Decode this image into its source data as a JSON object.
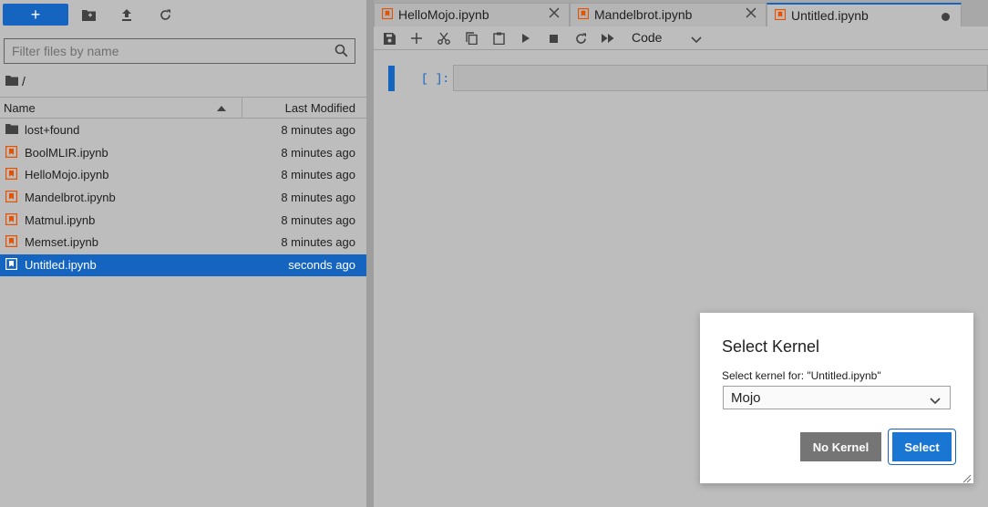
{
  "toolbar": {
    "new_label": "+"
  },
  "filter": {
    "placeholder": "Filter files by name"
  },
  "breadcrumb": {
    "root": "/"
  },
  "listing": {
    "name_header": "Name",
    "modified_header": "Last Modified",
    "items": [
      {
        "name": "lost+found",
        "modified": "8 minutes ago",
        "type": "folder"
      },
      {
        "name": "BoolMLIR.ipynb",
        "modified": "8 minutes ago",
        "type": "notebook"
      },
      {
        "name": "HelloMojo.ipynb",
        "modified": "8 minutes ago",
        "type": "notebook"
      },
      {
        "name": "Mandelbrot.ipynb",
        "modified": "8 minutes ago",
        "type": "notebook"
      },
      {
        "name": "Matmul.ipynb",
        "modified": "8 minutes ago",
        "type": "notebook"
      },
      {
        "name": "Memset.ipynb",
        "modified": "8 minutes ago",
        "type": "notebook"
      },
      {
        "name": "Untitled.ipynb",
        "modified": "seconds ago",
        "type": "notebook",
        "selected": true
      }
    ]
  },
  "tabs": [
    {
      "label": "HelloMojo.ipynb"
    },
    {
      "label": "Mandelbrot.ipynb"
    },
    {
      "label": "Untitled.ipynb"
    }
  ],
  "notebook": {
    "cell_type": "Code",
    "prompt": "[ ]:"
  },
  "dialog": {
    "title": "Select Kernel",
    "label": "Select kernel for: \"Untitled.ipynb\"",
    "selected_kernel": "Mojo",
    "no_kernel_label": "No Kernel",
    "select_label": "Select"
  },
  "colors": {
    "accent": "#1565c0",
    "notebook_icon": "#e65100",
    "background": "#bdbdbd"
  }
}
